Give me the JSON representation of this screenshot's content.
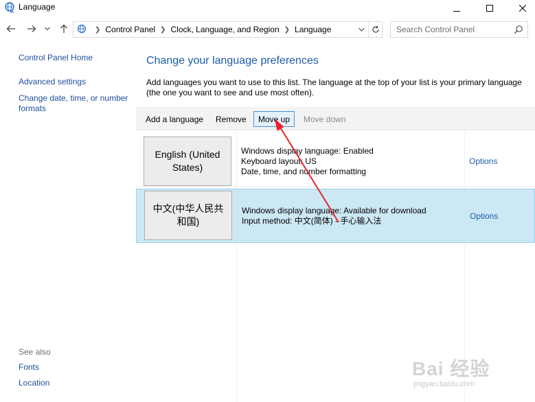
{
  "window": {
    "title": "Language"
  },
  "address_bar": {
    "crumbs": [
      "Control Panel",
      "Clock, Language, and Region",
      "Language"
    ]
  },
  "search": {
    "placeholder": "Search Control Panel"
  },
  "left_pane": {
    "home_link": "Control Panel Home",
    "advanced_settings": "Advanced settings",
    "change_date": "Change date, time, or number formats",
    "see_also": "See also",
    "fonts": "Fonts",
    "location": "Location"
  },
  "main": {
    "title": "Change your language preferences",
    "description": "Add languages you want to use to this list. The language at the top of your list is your primary language (the one you want to see and use most often)."
  },
  "toolbar": {
    "add": "Add a language",
    "remove": "Remove",
    "move_up": "Move up",
    "move_down": "Move down"
  },
  "languages": [
    {
      "name": "English (United States)",
      "info": [
        "Windows display language: Enabled",
        "Keyboard layout: US",
        "Date, time, and number formatting"
      ],
      "options": "Options"
    },
    {
      "name": "中文(中华人民共和国)",
      "info": [
        "Windows display language: Available for download",
        "Input method: 中文(简体) - 手心输入法"
      ],
      "options": "Options"
    }
  ],
  "watermark": {
    "logo": "Bai 经验",
    "url": "jingyan.baidu.com"
  },
  "colors": {
    "link": "#1e5aa8",
    "selected_row": "#cce8f5",
    "annotation_arrow": "#e8232b"
  }
}
